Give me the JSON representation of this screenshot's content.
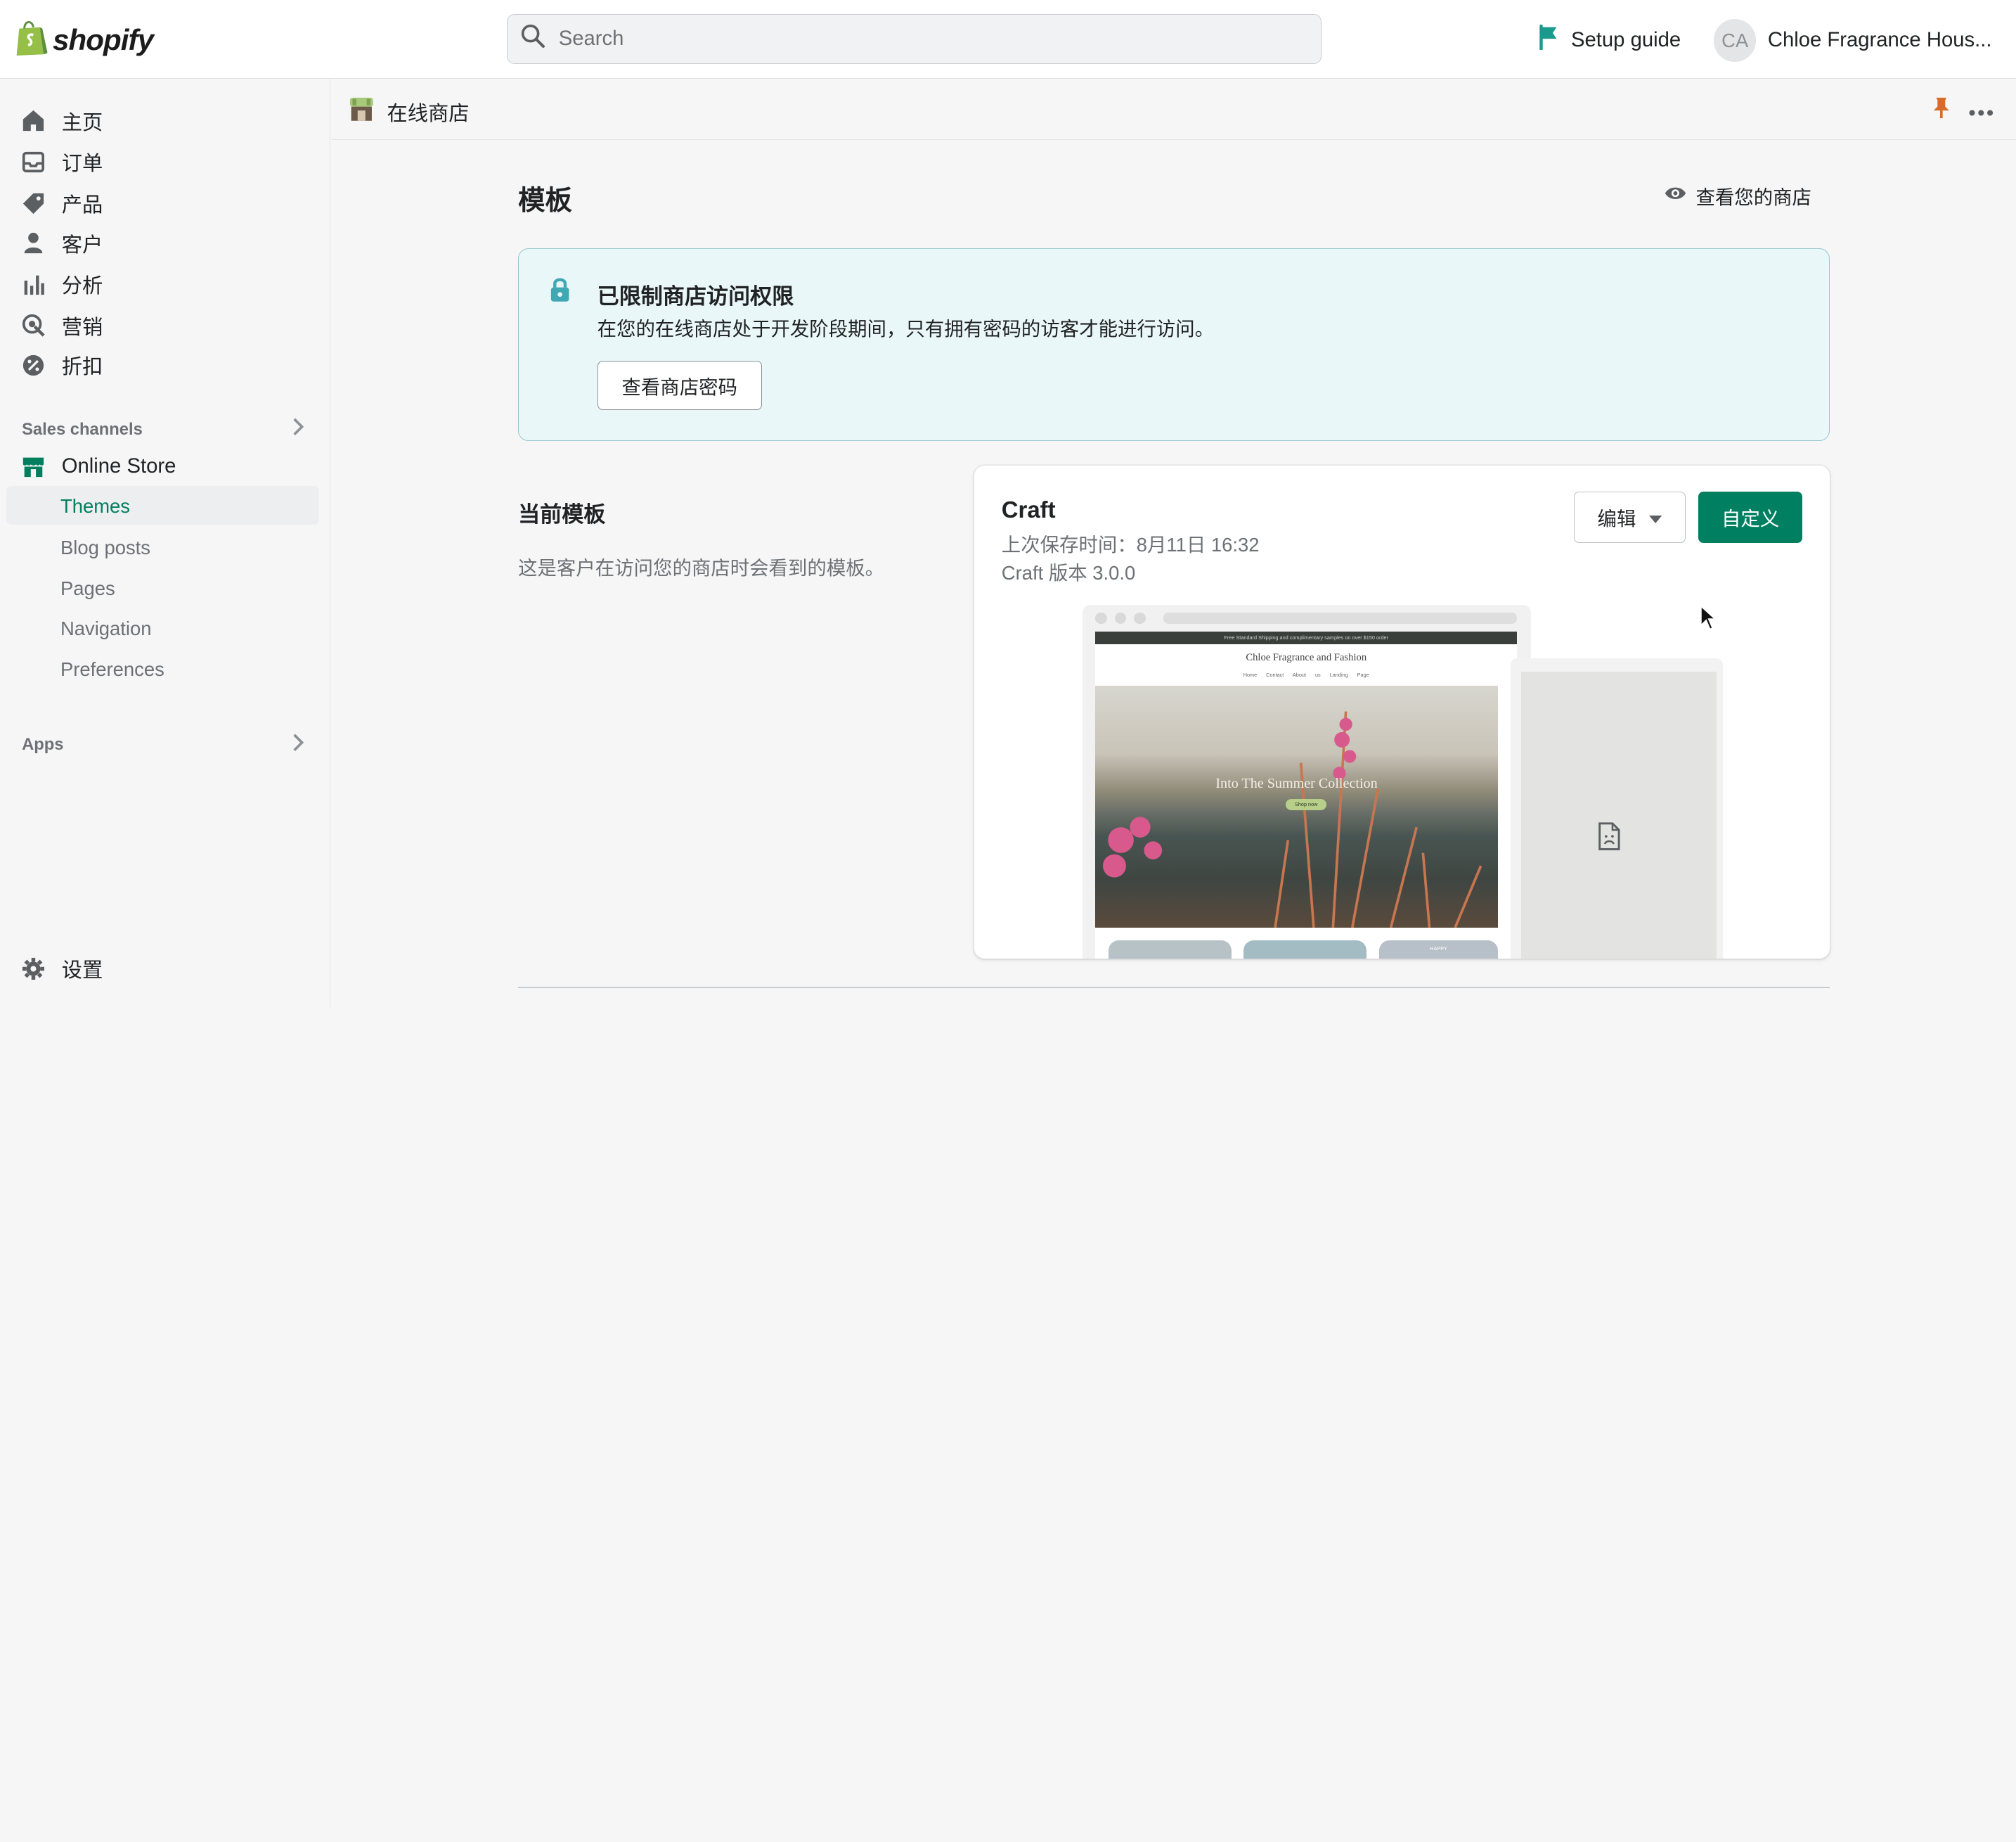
{
  "topbar": {
    "logo_text": "shopify",
    "search_placeholder": "Search",
    "setup_guide": "Setup guide",
    "avatar_initials": "CA",
    "store_name": "Chloe Fragrance Hous..."
  },
  "sidebar": {
    "items": [
      {
        "label": "主页",
        "icon": "home-icon"
      },
      {
        "label": "订单",
        "icon": "orders-icon"
      },
      {
        "label": "产品",
        "icon": "tag-icon"
      },
      {
        "label": "客户",
        "icon": "person-icon"
      },
      {
        "label": "分析",
        "icon": "bar-chart-icon"
      },
      {
        "label": "营销",
        "icon": "marketing-icon"
      },
      {
        "label": "折扣",
        "icon": "discount-icon"
      }
    ],
    "sales_channels_title": "Sales channels",
    "online_store": "Online Store",
    "online_store_subitems": [
      "Themes",
      "Blog posts",
      "Pages",
      "Navigation",
      "Preferences"
    ],
    "active_subitem": "Themes",
    "apps_title": "Apps",
    "settings": "设置"
  },
  "pagebar": {
    "title": "在线商店"
  },
  "main": {
    "page_title": "模板",
    "view_store": "查看您的商店",
    "banner": {
      "title": "已限制商店访问权限",
      "text": "在您的在线商店处于开发阶段期间，只有拥有密码的访客才能进行访问。",
      "button": "查看商店密码"
    },
    "current_theme": {
      "section_title": "当前模板",
      "section_desc": "这是客户在访问您的商店时会看到的模板。",
      "name": "Craft",
      "last_saved": "上次保存时间：8月11日 16:32",
      "version": "Craft 版本 3.0.0",
      "edit_button": "编辑",
      "customize_button": "自定义"
    },
    "preview": {
      "announcement": "Free Standard Shipping and complimentary samples on over $150 order",
      "store_name": "Chloe Fragrance and Fashion",
      "nav": "Home Contact About us Landing Page",
      "hero_title": "Into The Summer Collection",
      "hero_button": "Shop now",
      "bottom_label": "HAPPY"
    }
  },
  "colors": {
    "accent": "#008060",
    "banner_bg": "#eaf7f9",
    "banner_border": "#98c6cd",
    "lock_icon": "#3fa8b2",
    "flag_icon": "#1a9a8c",
    "pin_icon": "#d86b2a"
  }
}
